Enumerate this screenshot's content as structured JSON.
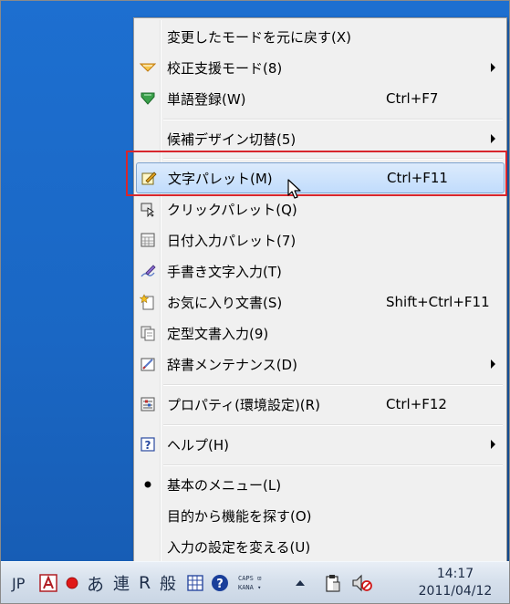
{
  "menu": {
    "items": [
      {
        "label": "変更したモードを元に戻す(X)",
        "mnemonic_index": 12,
        "shortcut": "",
        "submenu": false,
        "icon": "none"
      },
      {
        "label": "校正支援モード(8)",
        "shortcut": "",
        "submenu": true,
        "icon": "check-pencil-icon"
      },
      {
        "label": "単語登録(W)",
        "shortcut": "Ctrl+F7",
        "submenu": false,
        "icon": "book-arrow-icon"
      },
      {
        "label": "候補デザイン切替(5)",
        "shortcut": "",
        "submenu": true,
        "icon": "none"
      },
      {
        "label": "文字パレット(M)",
        "shortcut": "Ctrl+F11",
        "submenu": false,
        "icon": "char-palette-icon",
        "highlighted": true
      },
      {
        "label": "クリックパレット(Q)",
        "shortcut": "",
        "submenu": false,
        "icon": "click-palette-icon"
      },
      {
        "label": "日付入力パレット(7)",
        "shortcut": "",
        "submenu": false,
        "icon": "calendar-icon"
      },
      {
        "label": "手書き文字入力(T)",
        "shortcut": "",
        "submenu": false,
        "icon": "handwriting-pen-icon"
      },
      {
        "label": "お気に入り文書(S)",
        "shortcut": "Shift+Ctrl+F11",
        "submenu": false,
        "icon": "star-document-icon"
      },
      {
        "label": "定型文書入力(9)",
        "shortcut": "",
        "submenu": false,
        "icon": "template-document-icon"
      },
      {
        "label": "辞書メンテナンス(D)",
        "shortcut": "",
        "submenu": true,
        "icon": "dictionary-icon"
      },
      {
        "label": "プロパティ(環境設定)(R)",
        "shortcut": "Ctrl+F12",
        "submenu": false,
        "icon": "properties-icon"
      },
      {
        "label": "ヘルプ(H)",
        "shortcut": "",
        "submenu": true,
        "icon": "help-icon"
      },
      {
        "label": "基本のメニュー(L)",
        "shortcut": "",
        "submenu": false,
        "icon": "bullet-icon"
      },
      {
        "label": "目的から機能を探す(O)",
        "shortcut": "",
        "submenu": false,
        "icon": "none"
      },
      {
        "label": "入力の設定を変える(U)",
        "shortcut": "",
        "submenu": false,
        "icon": "none"
      }
    ]
  },
  "taskbar": {
    "lang": "JP",
    "mode_hiragana": "あ",
    "mode_ren": "連",
    "mode_r": "R",
    "mode_han": "般",
    "caps": "CAPS",
    "kana": "KANA",
    "time": "14:17",
    "date": "2011/04/12"
  },
  "colors": {
    "highlight_box": "#d8262c",
    "desktop": "#1a67c4",
    "menu_bg": "#f0f0f0"
  }
}
